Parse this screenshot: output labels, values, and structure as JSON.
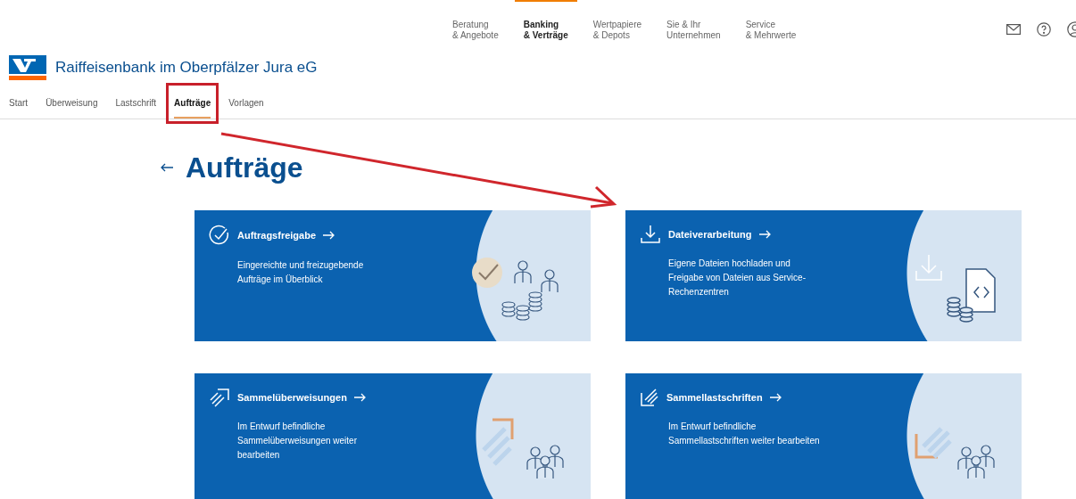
{
  "top_nav": [
    {
      "lines": [
        "Beratung",
        "& Angebote"
      ],
      "selected": false
    },
    {
      "lines": [
        "Banking",
        "& Verträge"
      ],
      "selected": true
    },
    {
      "lines": [
        "Wertpapiere",
        "& Depots"
      ],
      "selected": false
    },
    {
      "lines": [
        "Sie & Ihr",
        "Unternehmen"
      ],
      "selected": false
    },
    {
      "lines": [
        "Service",
        "& Mehrwerte"
      ],
      "selected": false
    }
  ],
  "bank_name": "Raiffeisenbank im Oberpfälzer Jura eG",
  "tabs": [
    {
      "label": "Start",
      "selected": false,
      "highlighted": false
    },
    {
      "label": "Überweisung",
      "selected": false,
      "highlighted": false
    },
    {
      "label": "Lastschrift",
      "selected": false,
      "highlighted": false
    },
    {
      "label": "Aufträge",
      "selected": true,
      "highlighted": true
    },
    {
      "label": "Vorlagen",
      "selected": false,
      "highlighted": false
    }
  ],
  "page_title": "Aufträge",
  "cards": [
    {
      "kind": "release",
      "title": "Auftragsfreigabe",
      "description": "Eingereichte und freizugebende Aufträge im Überblick"
    },
    {
      "kind": "file",
      "title": "Dateiverarbeitung",
      "description": "Eigene Dateien hochladen und Freigabe von Dateien aus Service-Rechenzentren"
    },
    {
      "kind": "transfer",
      "title": "Sammelüberweisungen",
      "description": "Im Entwurf befindliche Sammelüberweisungen weiter bearbeiten"
    },
    {
      "kind": "debit",
      "title": "Sammellastschriften",
      "description": "Im Entwurf befindliche Sammellastschriften weiter bearbeiten"
    }
  ]
}
